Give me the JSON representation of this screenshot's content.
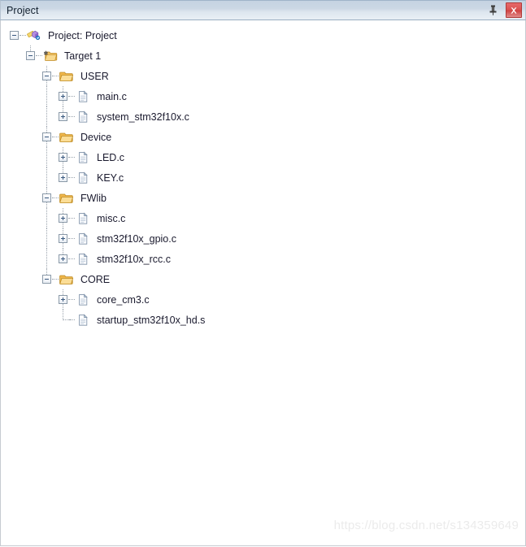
{
  "window": {
    "title": "Project",
    "pin_icon": "pin-icon",
    "close_icon": "close-icon",
    "close_glyph": "✕",
    "pin_glyph": "📌"
  },
  "colors": {
    "titlebar_top": "#c5d3e2",
    "titlebar_bottom": "#e9eff5",
    "close_button": "#d9504f",
    "folder": "#f0b64a",
    "text": "#1a1a2e",
    "guide_line": "#9aa3ad",
    "watermark": "#ebebeb"
  },
  "tree": {
    "nodes": [
      {
        "id": "project-root",
        "label": "Project: Project",
        "icon": "project-icon",
        "depth": 0,
        "state": "expanded",
        "toggle": "minus",
        "last": false,
        "guides": []
      },
      {
        "id": "target-1",
        "label": "Target 1",
        "icon": "target-folder-icon",
        "depth": 1,
        "state": "expanded",
        "toggle": "minus",
        "last": true,
        "guides": []
      },
      {
        "id": "group-user",
        "label": "USER",
        "icon": "folder-open-icon",
        "depth": 2,
        "state": "expanded",
        "toggle": "minus",
        "last": false,
        "guides": []
      },
      {
        "id": "file-main-c",
        "label": "main.c",
        "icon": "c-file-icon",
        "depth": 3,
        "state": "collapsed",
        "toggle": "plus",
        "last": false,
        "guides": []
      },
      {
        "id": "file-system-stm32f10x-c",
        "label": "system_stm32f10x.c",
        "icon": "c-file-icon",
        "depth": 3,
        "state": "collapsed",
        "toggle": "plus",
        "last": true,
        "guides": []
      },
      {
        "id": "group-device",
        "label": "Device",
        "icon": "folder-open-icon",
        "depth": 2,
        "state": "expanded",
        "toggle": "minus",
        "last": false,
        "guides": []
      },
      {
        "id": "file-led-c",
        "label": "LED.c",
        "icon": "c-file-icon",
        "depth": 3,
        "state": "collapsed",
        "toggle": "plus",
        "last": false,
        "guides": []
      },
      {
        "id": "file-key-c",
        "label": "KEY.c",
        "icon": "c-file-icon",
        "depth": 3,
        "state": "collapsed",
        "toggle": "plus",
        "last": true,
        "guides": []
      },
      {
        "id": "group-fwlib",
        "label": "FWlib",
        "icon": "folder-open-icon",
        "depth": 2,
        "state": "expanded",
        "toggle": "minus",
        "last": false,
        "guides": []
      },
      {
        "id": "file-misc-c",
        "label": "misc.c",
        "icon": "c-file-icon",
        "depth": 3,
        "state": "collapsed",
        "toggle": "plus",
        "last": false,
        "guides": []
      },
      {
        "id": "file-stm32f10x-gpio-c",
        "label": "stm32f10x_gpio.c",
        "icon": "c-file-icon",
        "depth": 3,
        "state": "collapsed",
        "toggle": "plus",
        "last": false,
        "guides": []
      },
      {
        "id": "file-stm32f10x-rcc-c",
        "label": "stm32f10x_rcc.c",
        "icon": "c-file-icon",
        "depth": 3,
        "state": "collapsed",
        "toggle": "plus",
        "last": true,
        "guides": []
      },
      {
        "id": "group-core",
        "label": "CORE",
        "icon": "folder-open-icon",
        "depth": 2,
        "state": "expanded",
        "toggle": "minus",
        "last": true,
        "guides": []
      },
      {
        "id": "file-core-cm3-c",
        "label": "core_cm3.c",
        "icon": "c-file-icon",
        "depth": 3,
        "state": "collapsed",
        "toggle": "plus",
        "last": false,
        "guides": []
      },
      {
        "id": "file-startup-stm32f10x-hd-s",
        "label": "startup_stm32f10x_hd.s",
        "icon": "asm-file-icon",
        "depth": 3,
        "state": "leaf",
        "toggle": "none",
        "last": true,
        "guides": []
      }
    ]
  },
  "watermark": {
    "text": "https://blog.csdn.net/s134359649"
  }
}
